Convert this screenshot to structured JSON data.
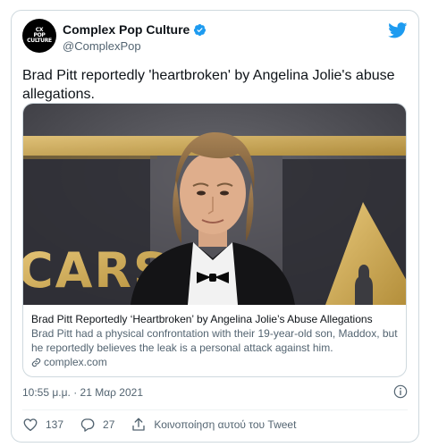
{
  "account": {
    "display_name": "Complex Pop Culture",
    "handle": "@ComplexPop",
    "avatar_lines": [
      "CX",
      "POP",
      "CULTURE"
    ]
  },
  "tweet": {
    "text": "Brad Pitt reportedly 'heartbroken' by Angelina Jolie's abuse allegations.",
    "timestamp": "10:55 μ.μ. · 21 Μαρ 2021"
  },
  "link_card": {
    "title": "Brad Pitt Reportedly ‘Heartbroken’ by Angelina Jolie’s Abuse Allegations",
    "description": "Brad Pitt had a physical confrontation with their 19-year-old son, Maddox, but he reportedly believes the leak is a personal attack against him.",
    "domain": "complex.com",
    "image_backdrop_text": "CARS"
  },
  "actions": {
    "likes": "137",
    "replies": "27",
    "share_label": "Κοινοποίηση αυτού του Tweet"
  },
  "colors": {
    "twitter_blue": "#1d9bf0",
    "text_primary": "#0f1419",
    "text_secondary": "#536471",
    "border": "#cfd9de"
  },
  "icons": [
    "verified-icon",
    "twitter-bird-icon",
    "link-icon",
    "info-icon",
    "heart-icon",
    "reply-icon",
    "share-icon"
  ]
}
